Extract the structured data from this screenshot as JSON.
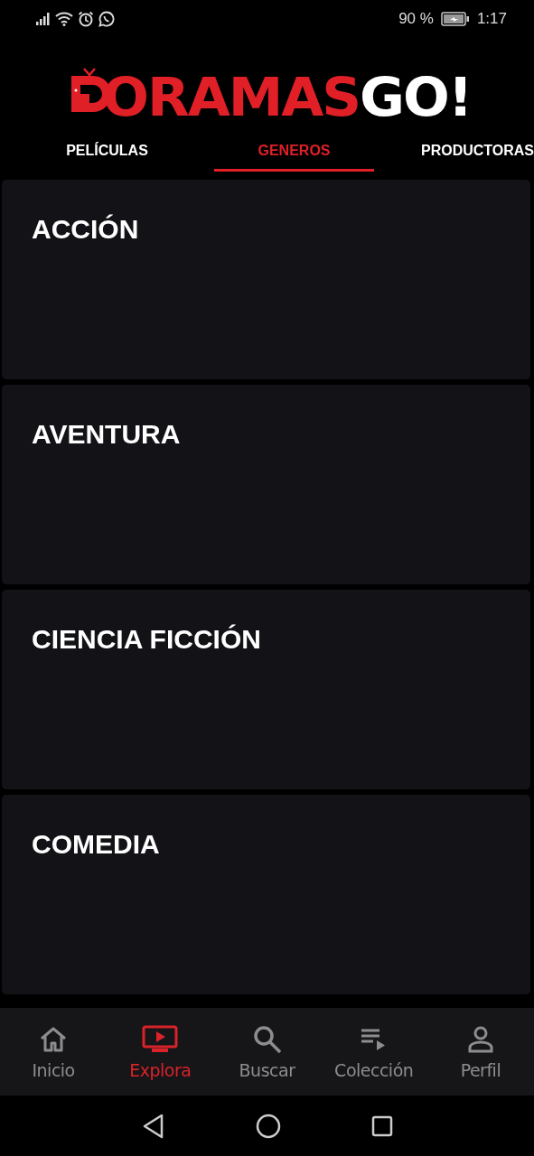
{
  "status_bar": {
    "battery_percent": "90 %",
    "time": "1:17"
  },
  "logo": {
    "word": "ORAMAS",
    "suffix": "GO!"
  },
  "tabs": [
    {
      "label": "PELÍCULAS",
      "selected": false
    },
    {
      "label": "GENEROS",
      "selected": true
    },
    {
      "label": "PRODUCTORAS",
      "selected": false
    }
  ],
  "genres": [
    {
      "title": "ACCIÓN"
    },
    {
      "title": "AVENTURA"
    },
    {
      "title": "CIENCIA FICCIÓN"
    },
    {
      "title": "COMEDIA"
    }
  ],
  "bottom_nav": [
    {
      "kind": "home",
      "label": "Inicio",
      "selected": false
    },
    {
      "kind": "explore",
      "label": "Explora",
      "selected": true
    },
    {
      "kind": "search",
      "label": "Buscar",
      "selected": false
    },
    {
      "kind": "collection",
      "label": "Colección",
      "selected": false
    },
    {
      "kind": "profile",
      "label": "Perfil",
      "selected": false
    }
  ]
}
